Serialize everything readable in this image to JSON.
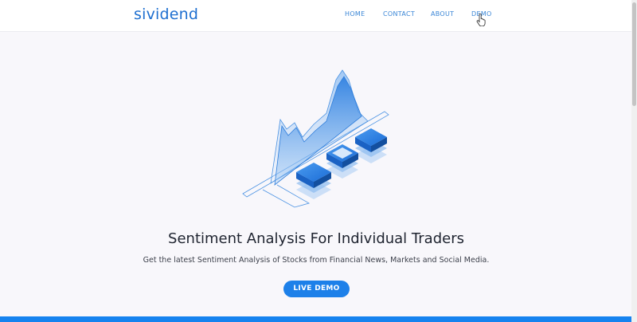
{
  "brand": {
    "logo_text": "sividend",
    "accent_color": "#1e6fd0",
    "button_color": "#1d80e9"
  },
  "nav": {
    "items": [
      {
        "label": "HOME"
      },
      {
        "label": "CONTACT"
      },
      {
        "label": "ABOUT"
      },
      {
        "label": "DEMO"
      }
    ]
  },
  "hero": {
    "illustration_icon": "area-chart-isometric-illustration",
    "title": "Sentiment Analysis For Individual Traders",
    "subtitle": "Get the latest Sentiment Analysis of Stocks from Financial News, Markets and Social Media.",
    "cta_label": "LIVE DEMO"
  },
  "cursor": {
    "icon": "hand-pointer-icon"
  }
}
